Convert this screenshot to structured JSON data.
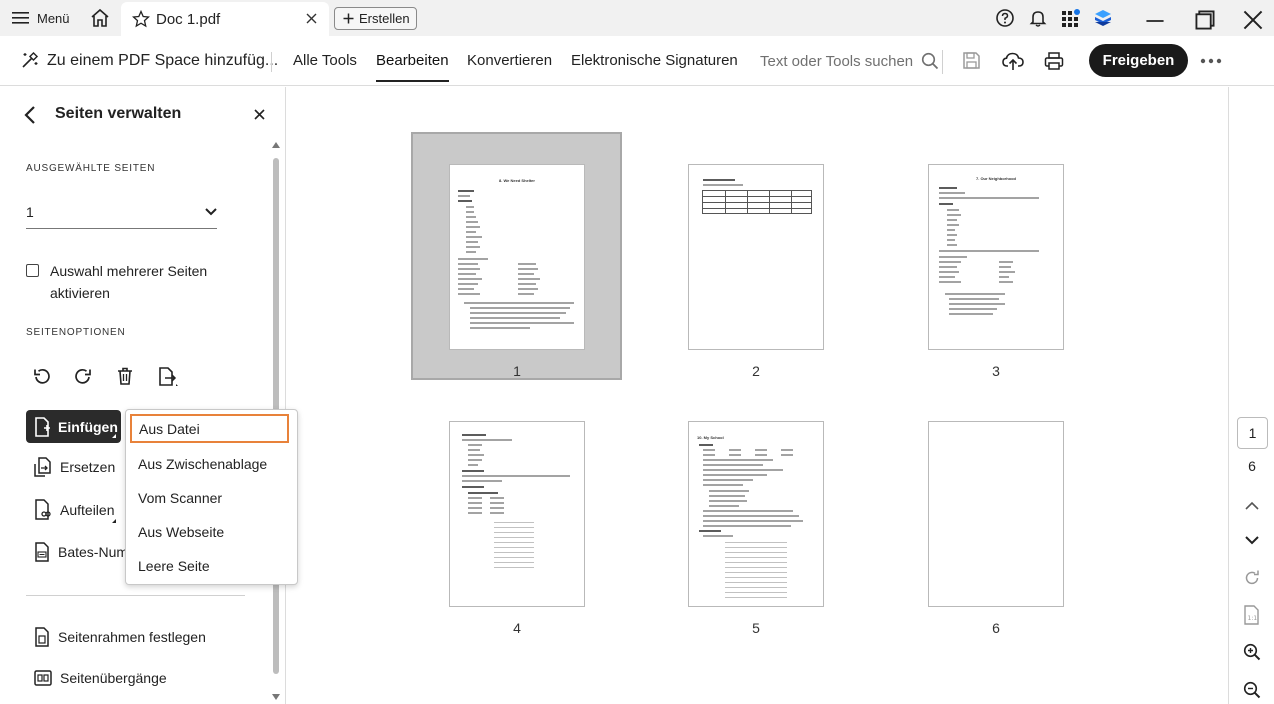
{
  "titlebar": {
    "menu_label": "Menü",
    "tab_title": "Doc 1.pdf",
    "create_label": "Erstellen"
  },
  "toolbar": {
    "add_space_label": "Zu einem PDF Space hinzufüg...",
    "tabs": [
      "Alle Tools",
      "Bearbeiten",
      "Konvertieren",
      "Elektronische Signaturen"
    ],
    "active_tab": "Bearbeiten",
    "search_placeholder": "Text oder Tools suchen",
    "share_label": "Freigeben"
  },
  "left_panel": {
    "title": "Seiten verwalten",
    "selected_pages_label": "AUSGEWÄHLTE SEITEN",
    "selected_pages_value": "1",
    "multi_select_label": "Auswahl mehrerer Seiten aktivieren",
    "page_options_label": "SEITENOPTIONEN",
    "insert_label": "Einfügen",
    "replace_label": "Ersetzen",
    "split_label": "Aufteilen",
    "bates_label": "Bates-Numm",
    "crop_label": "Seitenrahmen festlegen",
    "transitions_label": "Seitenübergänge"
  },
  "insert_menu": {
    "items": [
      "Aus Datei",
      "Aus Zwischenablage",
      "Vom Scanner",
      "Aus Webseite",
      "Leere Seite"
    ],
    "focused_item": "Aus Datei"
  },
  "pages": {
    "labels": [
      "1",
      "2",
      "3",
      "4",
      "5",
      "6"
    ],
    "selected": "1",
    "page1_heading": "8. We Need Shelter",
    "page3_heading": "7. Our Neighborhood",
    "page5_heading": "10. My School"
  },
  "right_rail": {
    "current_page": "1",
    "total_pages": "6"
  },
  "colors": {
    "share_button_bg": "#1a1a1a",
    "menu_focus_border": "#e8823a",
    "selected_page_bg": "#c9c9c9"
  }
}
